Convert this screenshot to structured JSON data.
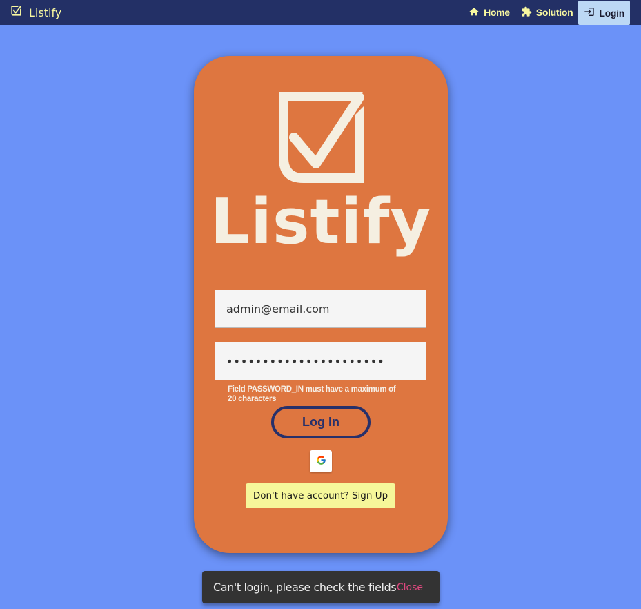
{
  "app": {
    "name": "Listify"
  },
  "nav": {
    "items": [
      {
        "label": "Home",
        "icon": "home-icon"
      },
      {
        "label": "Solution",
        "icon": "puzzle-icon"
      },
      {
        "label": "Login",
        "icon": "login-icon",
        "active": true
      }
    ]
  },
  "login": {
    "logo_text": "Listify",
    "email_value": "admin@email.com",
    "password_value": "••••••••••••••••••••••",
    "error_line1": "Field PASSWORD_IN must have a maximum of",
    "error_line2": "20 characters",
    "login_button": "Log In",
    "google_icon": "google-icon",
    "signup_button": "Don't have account? Sign Up"
  },
  "snackbar": {
    "message": "Can't login, please check the fields",
    "close_label": "Close"
  },
  "colors": {
    "topbar": "#233066",
    "background": "#6b92f8",
    "card": "#de7640",
    "accent_text": "#f7f7a0",
    "button_border": "#27306a",
    "signup_bg": "#f6f79a",
    "snackbar_bg": "#333333",
    "close_color": "#e0487f"
  }
}
